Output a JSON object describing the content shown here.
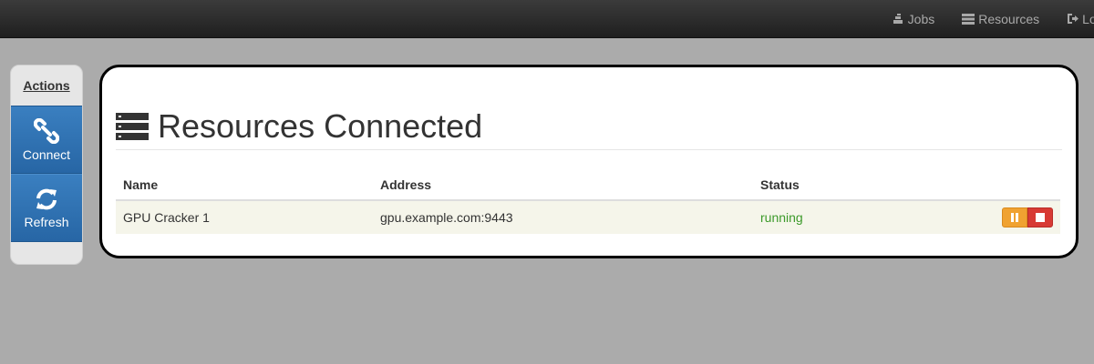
{
  "navbar": {
    "items": [
      {
        "label": "Jobs",
        "icon": "jobs-icon"
      },
      {
        "label": "Resources",
        "icon": "server-icon"
      },
      {
        "label": "Logout",
        "icon": "logout-icon"
      }
    ]
  },
  "sidebar": {
    "title": "Actions",
    "buttons": [
      {
        "label": "Connect",
        "icon": "link-icon"
      },
      {
        "label": "Refresh",
        "icon": "refresh-icon"
      }
    ]
  },
  "main": {
    "title": "Resources Connected",
    "title_icon": "server-icon",
    "table": {
      "columns": [
        "Name",
        "Address",
        "Status",
        ""
      ],
      "rows": [
        {
          "name": "GPU Cracker 1",
          "address": "gpu.example.com:9443",
          "status": "running"
        }
      ]
    }
  },
  "colors": {
    "navbar_bg": "#2b2b2b",
    "page_bg": "#ababab",
    "sidebar_button": "#2f72b3",
    "status_running": "#3c9a2a",
    "pause_button": "#f0a231",
    "stop_button": "#d73a34"
  }
}
